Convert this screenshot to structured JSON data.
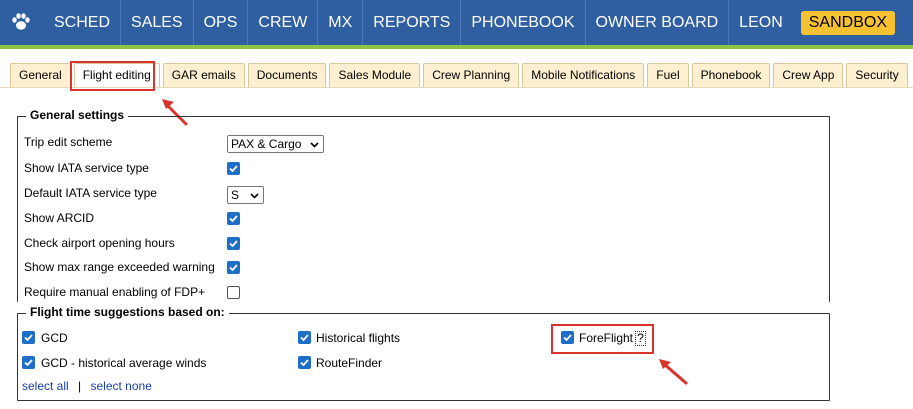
{
  "nav": {
    "items": [
      "SCHED",
      "SALES",
      "OPS",
      "CREW",
      "MX",
      "REPORTS",
      "PHONEBOOK",
      "OWNER BOARD",
      "LEON"
    ],
    "sandbox": "SANDBOX"
  },
  "tabs": [
    "General",
    "Flight editing",
    "GAR emails",
    "Documents",
    "Sales Module",
    "Crew Planning",
    "Mobile Notifications",
    "Fuel",
    "Phonebook",
    "Crew App",
    "Security"
  ],
  "general_settings": {
    "legend": "General settings",
    "trip_edit_scheme": {
      "label": "Trip edit scheme",
      "value": "PAX & Cargo"
    },
    "show_iata": {
      "label": "Show IATA service type",
      "checked": true
    },
    "default_iata": {
      "label": "Default IATA service type",
      "value": "S"
    },
    "show_arcid": {
      "label": "Show ARCID",
      "checked": true
    },
    "check_airport": {
      "label": "Check airport opening hours",
      "checked": true
    },
    "show_max_range": {
      "label": "Show max range exceeded warning",
      "checked": true
    },
    "require_fdp": {
      "label": "Require manual enabling of FDP+",
      "checked": false
    }
  },
  "flight_time": {
    "legend": "Flight time suggestions based on:",
    "gcd": {
      "label": "GCD",
      "checked": true
    },
    "gcd_hist": {
      "label": "GCD - historical average winds",
      "checked": true
    },
    "historical": {
      "label": "Historical flights",
      "checked": true
    },
    "routefinder": {
      "label": "RouteFinder",
      "checked": true
    },
    "foreflight": {
      "label": "ForeFlight",
      "checked": true,
      "help": "?"
    },
    "select_all": "select all",
    "separator": "|",
    "select_none": "select none"
  },
  "colors": {
    "nav_bg": "#2f5fa0",
    "nav_accent": "#8cc63f",
    "sandbox_bg": "#f6c232",
    "tab_bg": "#fdf0d0",
    "checkbox": "#1e6ec7",
    "annotation": "#d9342b",
    "link": "#1a3ea8"
  }
}
